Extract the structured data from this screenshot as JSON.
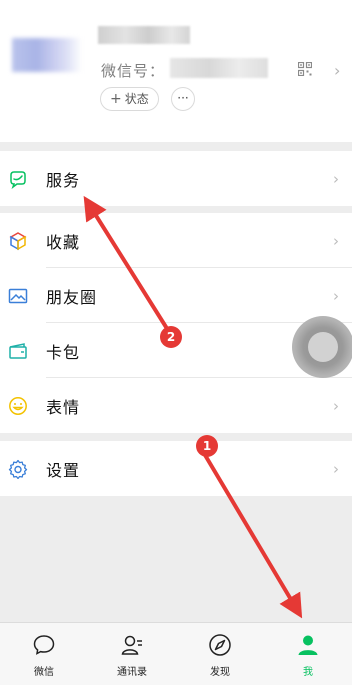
{
  "profile": {
    "wechat_id_label": "微信号：",
    "status_label": "状态",
    "more_label": "···"
  },
  "menu": {
    "services": "服务",
    "favorites": "收藏",
    "moments": "朋友圈",
    "cards": "卡包",
    "stickers": "表情",
    "settings": "设置"
  },
  "tabs": [
    {
      "label": "微信"
    },
    {
      "label": "通讯录"
    },
    {
      "label": "发现"
    },
    {
      "label": "我"
    }
  ],
  "annotations": {
    "badge_1": "1",
    "badge_2": "2"
  },
  "colors": {
    "accent_green": "#07c160",
    "arrow_red": "#e53935"
  }
}
